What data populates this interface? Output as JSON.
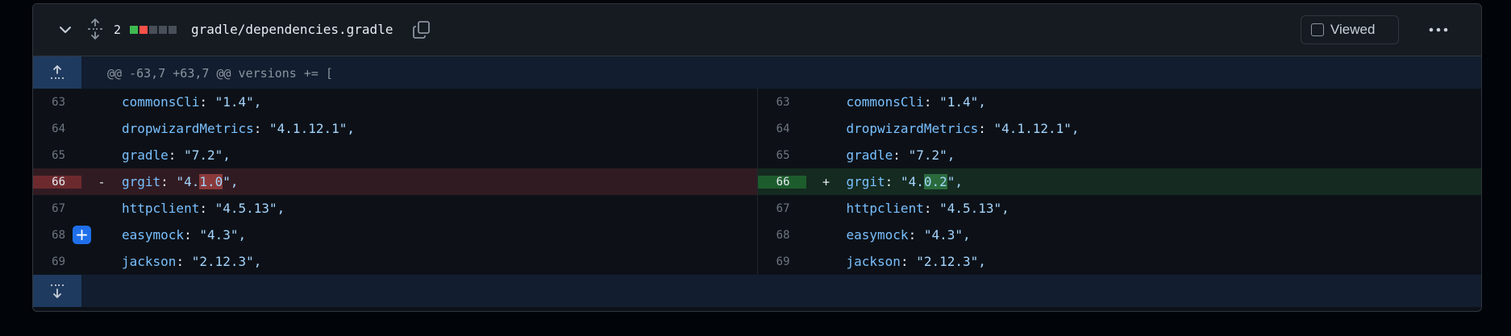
{
  "file": {
    "changes_count": "2",
    "filename": "gradle/dependencies.gradle",
    "viewed_label": "Viewed",
    "diffstat_colors": [
      "#3fb950",
      "#f85149",
      "#484f58",
      "#484f58",
      "#484f58"
    ]
  },
  "hunk": {
    "header": "@@ -63,7 +63,7 @@ versions += ["
  },
  "left": [
    {
      "num": "63",
      "sign": "",
      "key": "commonsCli",
      "pre": "\"1.4\",",
      "hl": "",
      "post": ""
    },
    {
      "num": "64",
      "sign": "",
      "key": "dropwizardMetrics",
      "pre": "\"4.1.12.1\",",
      "hl": "",
      "post": ""
    },
    {
      "num": "65",
      "sign": "",
      "key": "gradle",
      "pre": "\"7.2\",",
      "hl": "",
      "post": ""
    },
    {
      "num": "66",
      "sign": "-",
      "key": "grgit",
      "pre": "\"4.",
      "hl": "1.0",
      "post": "\","
    },
    {
      "num": "67",
      "sign": "",
      "key": "httpclient",
      "pre": "\"4.5.13\",",
      "hl": "",
      "post": ""
    },
    {
      "num": "68",
      "sign": "",
      "key": "easymock",
      "pre": "\"4.3\",",
      "hl": "",
      "post": ""
    },
    {
      "num": "69",
      "sign": "",
      "key": "jackson",
      "pre": "\"2.12.3\",",
      "hl": "",
      "post": ""
    }
  ],
  "right": [
    {
      "num": "63",
      "sign": "",
      "key": "commonsCli",
      "pre": "\"1.4\",",
      "hl": "",
      "post": ""
    },
    {
      "num": "64",
      "sign": "",
      "key": "dropwizardMetrics",
      "pre": "\"4.1.12.1\",",
      "hl": "",
      "post": ""
    },
    {
      "num": "65",
      "sign": "",
      "key": "gradle",
      "pre": "\"7.2\",",
      "hl": "",
      "post": ""
    },
    {
      "num": "66",
      "sign": "+",
      "key": "grgit",
      "pre": "\"4.",
      "hl": "0.2",
      "post": "\","
    },
    {
      "num": "67",
      "sign": "",
      "key": "httpclient",
      "pre": "\"4.5.13\",",
      "hl": "",
      "post": ""
    },
    {
      "num": "68",
      "sign": "",
      "key": "easymock",
      "pre": "\"4.3\",",
      "hl": "",
      "post": ""
    },
    {
      "num": "69",
      "sign": "",
      "key": "jackson",
      "pre": "\"2.12.3\",",
      "hl": "",
      "post": ""
    }
  ],
  "add_comment_label": "+"
}
